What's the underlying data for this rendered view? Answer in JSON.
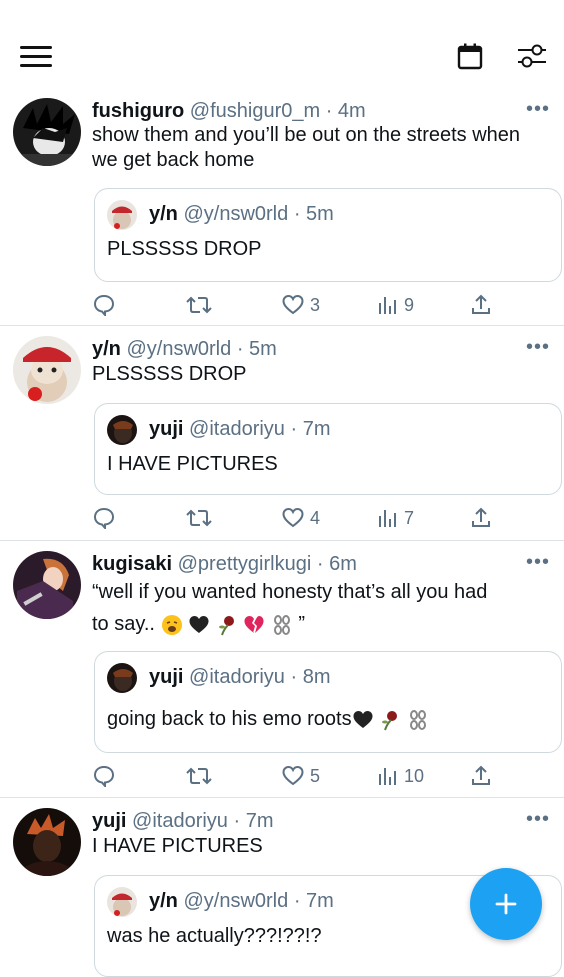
{
  "tweets": [
    {
      "name": "fushiguro",
      "handle": "@fushigur0_m",
      "time": "· 4m",
      "text": "show them and you’ll be out on the streets when we get back home",
      "quote": {
        "name": "y/n",
        "handle": "@y/nsw0rld",
        "time": "· 5m",
        "text": "PLSSSSS DROP"
      },
      "likes": "3",
      "views": "9"
    },
    {
      "name": "y/n",
      "handle": "@y/nsw0rld",
      "time": "· 5m",
      "text": "PLSSSSS DROP",
      "quote": {
        "name": "yuji",
        "handle": "@itadoriyu",
        "time": "· 7m",
        "text": "I HAVE PICTURES"
      },
      "likes": "4",
      "views": "7"
    },
    {
      "name": "kugisaki",
      "handle": "@prettygirlkugi",
      "time": "· 6m",
      "text_line1": "“well if you wanted honesty that’s all you had",
      "text_line2": "to say..",
      "text_end": "”",
      "quote": {
        "name": "yuji",
        "handle": "@itadoriyu",
        "time": "· 8m",
        "text": "going back to his emo roots"
      },
      "likes": "5",
      "views": "10"
    },
    {
      "name": "yuji",
      "handle": "@itadoriyu",
      "time": "· 7m",
      "text": "I HAVE PICTURES",
      "quote": {
        "name": "y/n",
        "handle": "@y/nsw0rld",
        "time": "· 7m",
        "text": "was he actually???!??!?"
      }
    }
  ],
  "colors": {
    "accent": "#1da1f2",
    "muted": "#5b7083",
    "border": "#cfd9de"
  },
  "icons": [
    "menu-icon",
    "calendar-icon",
    "filter-icon",
    "reply-icon",
    "retweet-icon",
    "like-icon",
    "views-icon",
    "share-icon",
    "compose-icon"
  ]
}
